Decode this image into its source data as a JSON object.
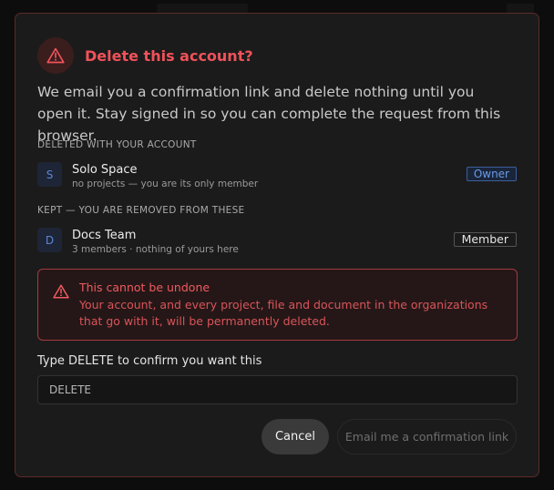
{
  "dialog": {
    "title": "Delete this account?",
    "description": "We email you a confirmation link and delete nothing until you open it. Stay signed in so you can complete the request from this browser.",
    "deleted_section": {
      "label": "DELETED WITH YOUR ACCOUNT",
      "orgs": [
        {
          "initial": "S",
          "name": "Solo Space",
          "meta": "no projects — you are its only member",
          "role": "Owner"
        }
      ]
    },
    "kept_section": {
      "label": "KEPT — YOU ARE REMOVED FROM THESE",
      "orgs": [
        {
          "initial": "D",
          "name": "Docs Team",
          "meta": "3 members · nothing of yours here",
          "role": "Member"
        }
      ]
    },
    "alert": {
      "title": "This cannot be undone",
      "body": "Your account, and every project, file and document in the organizations that go with it, will be permanently deleted."
    },
    "confirm": {
      "label": "Type DELETE to confirm you want this",
      "value": "DELETE"
    },
    "buttons": {
      "cancel": "Cancel",
      "submit": "Email me a confirmation link"
    }
  },
  "colors": {
    "danger": "#f0525a",
    "owner_badge": "#6b9ae6",
    "dialog_bg": "#1c1b1b"
  }
}
